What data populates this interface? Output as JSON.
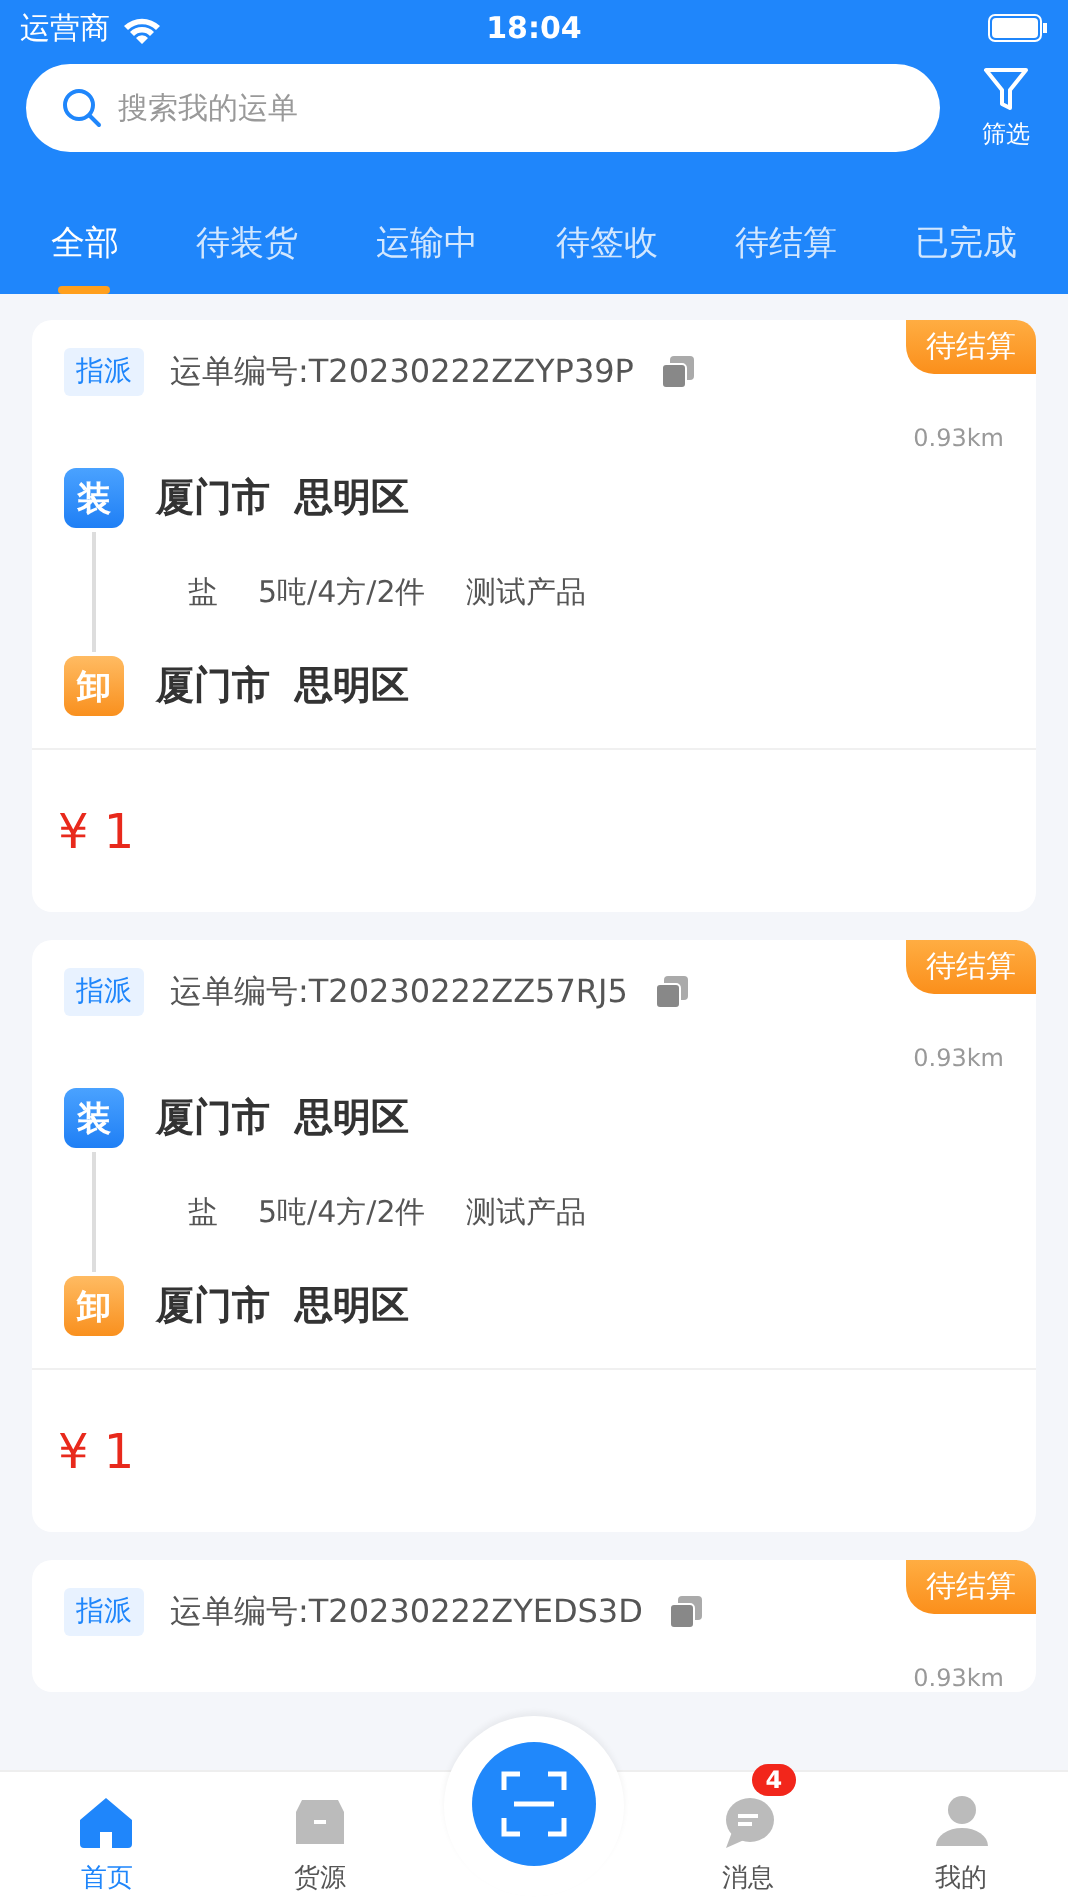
{
  "status_bar": {
    "carrier": "运营商",
    "time": "18:04"
  },
  "search": {
    "placeholder": "搜索我的运单"
  },
  "filter": {
    "label": "筛选"
  },
  "tabs": [
    {
      "label": "全部",
      "selected": true
    },
    {
      "label": "待装货",
      "selected": false
    },
    {
      "label": "运输中",
      "selected": false
    },
    {
      "label": "待签收",
      "selected": false
    },
    {
      "label": "待结算",
      "selected": false
    },
    {
      "label": "已完成",
      "selected": false
    }
  ],
  "orders": [
    {
      "tag": "指派",
      "number": "运单编号:T20230222ZZYP39P",
      "status": "待结算",
      "distance": "0.93km",
      "load": {
        "icon": "装",
        "city": "厦门市",
        "district": "思明区"
      },
      "goods": [
        "盐",
        "5吨/4方/2件",
        "测试产品"
      ],
      "unload": {
        "icon": "卸",
        "city": "厦门市",
        "district": "思明区"
      },
      "price": "¥ 1"
    },
    {
      "tag": "指派",
      "number": "运单编号:T20230222ZZ57RJ5",
      "status": "待结算",
      "distance": "0.93km",
      "load": {
        "icon": "装",
        "city": "厦门市",
        "district": "思明区"
      },
      "goods": [
        "盐",
        "5吨/4方/2件",
        "测试产品"
      ],
      "unload": {
        "icon": "卸",
        "city": "厦门市",
        "district": "思明区"
      },
      "price": "¥ 1"
    },
    {
      "tag": "指派",
      "number": "运单编号:T20230222ZYEDS3D",
      "status": "待结算",
      "distance": "0.93km"
    }
  ],
  "nav": [
    {
      "kind": "home",
      "label": "首页",
      "selected": true
    },
    {
      "kind": "box",
      "label": "货源",
      "selected": false
    },
    {
      "kind": "scan",
      "selected": false
    },
    {
      "kind": "message",
      "label": "消息",
      "selected": false,
      "badge": "4"
    },
    {
      "kind": "user",
      "label": "我的",
      "selected": false
    }
  ]
}
